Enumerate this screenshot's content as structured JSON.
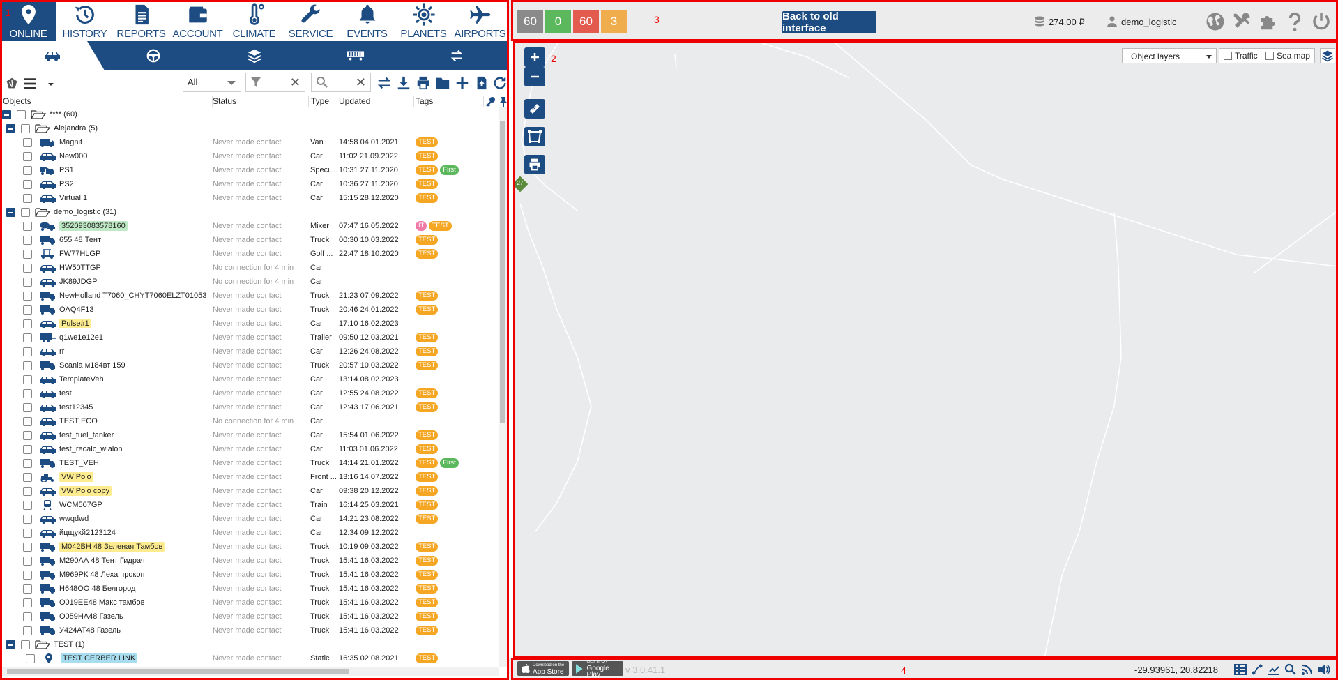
{
  "nav": {
    "items": [
      {
        "label": "ONLINE",
        "icon": "pin-icon"
      },
      {
        "label": "HISTORY",
        "icon": "history-icon"
      },
      {
        "label": "REPORTS",
        "icon": "report-icon"
      },
      {
        "label": "ACCOUNT",
        "icon": "wallet-icon"
      },
      {
        "label": "CLIMATE",
        "icon": "thermometer-icon"
      },
      {
        "label": "SERVICE",
        "icon": "wrench-icon"
      },
      {
        "label": "EVENTS",
        "icon": "bell-icon"
      },
      {
        "label": "PLANETS",
        "icon": "sun-icon"
      },
      {
        "label": "AIRPORTS",
        "icon": "plane-icon"
      }
    ]
  },
  "subtabs": [
    "car-icon",
    "steering-wheel-icon",
    "layers-icon",
    "train-icon",
    "swap-icon"
  ],
  "toolbar": {
    "filter_select_value": "All",
    "icons": [
      "transfer-icon",
      "download-icon",
      "print-icon",
      "folder-icon",
      "plus-icon",
      "upload-icon",
      "refresh-icon"
    ]
  },
  "columns": {
    "objects": "Objects",
    "status": "Status",
    "type": "Type",
    "updated": "Updated",
    "tags": "Tags"
  },
  "tags": {
    "test": "TEST",
    "first": "First",
    "it": "IT"
  },
  "colors": {
    "brand": "#1c4c82",
    "test_tag": "#f5a623",
    "first_tag": "#5cb85c",
    "it_tag": "#f07aa6",
    "hl_yellow": "#fdeb8f",
    "hl_green": "#bfe8c4",
    "hl_blue": "#a8ddef"
  },
  "rows": [
    {
      "kind": "group",
      "level": 0,
      "name": "**** (60)"
    },
    {
      "kind": "group",
      "level": 1,
      "name": "Alejandra (5)"
    },
    {
      "kind": "obj",
      "name": "Magnit",
      "status": "Never made contact",
      "type": "Van",
      "updated": "14:58 04.01.2021",
      "tags": [
        "test"
      ],
      "icon": "van-icon"
    },
    {
      "kind": "obj",
      "name": "New000",
      "status": "Never made contact",
      "type": "Car",
      "updated": "11:02 21.09.2022",
      "tags": [
        "test"
      ],
      "icon": "car-icon"
    },
    {
      "kind": "obj",
      "name": "PS1",
      "status": "Never made contact",
      "type": "Speci...",
      "updated": "10:31 27.11.2020",
      "tags": [
        "test",
        "first"
      ],
      "icon": "special-icon"
    },
    {
      "kind": "obj",
      "name": "PS2",
      "status": "Never made contact",
      "type": "Car",
      "updated": "10:36 27.11.2020",
      "tags": [
        "test"
      ],
      "icon": "car-icon"
    },
    {
      "kind": "obj",
      "name": "Virtual 1",
      "status": "Never made contact",
      "type": "Car",
      "updated": "15:15 28.12.2020",
      "tags": [
        "test"
      ],
      "icon": "car-icon"
    },
    {
      "kind": "group",
      "level": 1,
      "name": "demo_logistic (31)"
    },
    {
      "kind": "obj",
      "name": "352093083578160",
      "hl": "green",
      "status": "Never made contact",
      "type": "Mixer",
      "updated": "07:47 16.05.2022",
      "tags": [
        "it",
        "test"
      ],
      "icon": "mixer-icon"
    },
    {
      "kind": "obj",
      "name": "655 48 Тент",
      "status": "Never made contact",
      "type": "Truck",
      "updated": "00:30 10.03.2022",
      "tags": [
        "test"
      ],
      "icon": "truck-icon"
    },
    {
      "kind": "obj",
      "name": "FW77HLGP",
      "status": "Never made contact",
      "type": "Golf ...",
      "updated": "22:47 18.10.2020",
      "tags": [
        "test"
      ],
      "icon": "golf-icon"
    },
    {
      "kind": "obj",
      "name": "HW50TTGP",
      "status": "No connection for 4 min",
      "type": "Car",
      "updated": "",
      "tags": [],
      "icon": "car-icon"
    },
    {
      "kind": "obj",
      "name": "JK89JDGP",
      "status": "No connection for 4 min",
      "type": "Car",
      "updated": "",
      "tags": [],
      "icon": "car-icon"
    },
    {
      "kind": "obj",
      "name": "NewHolland T7060_CHYT7060ELZT01053",
      "status": "Never made contact",
      "type": "Truck",
      "updated": "21:23 07.09.2022",
      "tags": [
        "test"
      ],
      "icon": "truck-icon"
    },
    {
      "kind": "obj",
      "name": "OAQ4F13",
      "status": "Never made contact",
      "type": "Truck",
      "updated": "20:46 24.01.2022",
      "tags": [
        "test"
      ],
      "icon": "truck-icon"
    },
    {
      "kind": "obj",
      "name": "Pulse#1",
      "hl": "yellow",
      "status": "Never made contact",
      "type": "Car",
      "updated": "17:10 16.02.2023",
      "tags": [],
      "icon": "car-icon"
    },
    {
      "kind": "obj",
      "name": "q1we1e12e1",
      "status": "Never made contact",
      "type": "Trailer",
      "updated": "09:50 12.03.2021",
      "tags": [
        "test"
      ],
      "icon": "trailer-icon"
    },
    {
      "kind": "obj",
      "name": "rr",
      "status": "Never made contact",
      "type": "Car",
      "updated": "12:26 24.08.2022",
      "tags": [
        "test"
      ],
      "icon": "car-icon"
    },
    {
      "kind": "obj",
      "name": "Scania м184вт 159",
      "status": "Never made contact",
      "type": "Truck",
      "updated": "20:57 10.03.2022",
      "tags": [
        "test"
      ],
      "icon": "truck-icon"
    },
    {
      "kind": "obj",
      "name": "TemplateVeh",
      "status": "Never made contact",
      "type": "Car",
      "updated": "13:14 08.02.2023",
      "tags": [],
      "icon": "car-icon"
    },
    {
      "kind": "obj",
      "name": "test",
      "status": "Never made contact",
      "type": "Car",
      "updated": "12:55 24.08.2022",
      "tags": [
        "test"
      ],
      "icon": "car-icon"
    },
    {
      "kind": "obj",
      "name": "test12345",
      "status": "Never made contact",
      "type": "Car",
      "updated": "12:43 17.06.2021",
      "tags": [
        "test"
      ],
      "icon": "car-icon"
    },
    {
      "kind": "obj",
      "name": "TEST ECO",
      "status": "No connection for 4 min",
      "type": "Car",
      "updated": "",
      "tags": [],
      "icon": "car-icon"
    },
    {
      "kind": "obj",
      "name": "test_fuel_tanker",
      "status": "Never made contact",
      "type": "Car",
      "updated": "15:54 01.06.2022",
      "tags": [
        "test"
      ],
      "icon": "car-icon"
    },
    {
      "kind": "obj",
      "name": "test_recalc_wialon",
      "status": "Never made contact",
      "type": "Car",
      "updated": "11:03 01.06.2022",
      "tags": [
        "test"
      ],
      "icon": "car-icon"
    },
    {
      "kind": "obj",
      "name": "TEST_VEH",
      "status": "Never made contact",
      "type": "Truck",
      "updated": "14:14 21.01.2022",
      "tags": [
        "test",
        "first"
      ],
      "icon": "truck-icon"
    },
    {
      "kind": "obj",
      "name": "VW Polo",
      "hl": "yellow",
      "status": "Never made contact",
      "type": "Front ...",
      "updated": "13:16 14.07.2022",
      "tags": [
        "test"
      ],
      "icon": "tractor-icon"
    },
    {
      "kind": "obj",
      "name": "VW Polo copy",
      "hl": "yellow",
      "status": "Never made contact",
      "type": "Car",
      "updated": "09:38 20.12.2022",
      "tags": [
        "test"
      ],
      "icon": "car-icon"
    },
    {
      "kind": "obj",
      "name": "WCM507GP",
      "status": "Never made contact",
      "type": "Train",
      "updated": "16:14 25.03.2021",
      "tags": [
        "test"
      ],
      "icon": "train-icon"
    },
    {
      "kind": "obj",
      "name": "wwqdwd",
      "status": "Never made contact",
      "type": "Car",
      "updated": "14:21 23.08.2022",
      "tags": [
        "test"
      ],
      "icon": "car-icon"
    },
    {
      "kind": "obj",
      "name": "йцщукй2123124",
      "status": "Never made contact",
      "type": "Car",
      "updated": "12:34 09.12.2022",
      "tags": [],
      "icon": "car-icon"
    },
    {
      "kind": "obj",
      "name": "М042ВН 48 Зеленая Тамбов",
      "hl": "yellow",
      "status": "Never made contact",
      "type": "Truck",
      "updated": "10:19 09.03.2022",
      "tags": [
        "test"
      ],
      "icon": "truck-icon"
    },
    {
      "kind": "obj",
      "name": "М290АА 48 Тент Гидрач",
      "status": "Never made contact",
      "type": "Truck",
      "updated": "15:41 16.03.2022",
      "tags": [
        "test"
      ],
      "icon": "truck-icon"
    },
    {
      "kind": "obj",
      "name": "М969РК 48 Леха прокоп",
      "status": "Never made contact",
      "type": "Truck",
      "updated": "15:41 16.03.2022",
      "tags": [
        "test"
      ],
      "icon": "truck-icon"
    },
    {
      "kind": "obj",
      "name": "Н648ОО 48 Белгород",
      "status": "Never made contact",
      "type": "Truck",
      "updated": "15:41 16.03.2022",
      "tags": [
        "test"
      ],
      "icon": "truck-icon"
    },
    {
      "kind": "obj",
      "name": "О019ЕЕ48 Макс тамбов",
      "status": "Never made contact",
      "type": "Truck",
      "updated": "15:41 16.03.2022",
      "tags": [
        "test"
      ],
      "icon": "truck-icon"
    },
    {
      "kind": "obj",
      "name": "О059НА48 Газель",
      "status": "Never made contact",
      "type": "Truck",
      "updated": "15:41 16.03.2022",
      "tags": [
        "test"
      ],
      "icon": "truck-icon"
    },
    {
      "kind": "obj",
      "name": "У424АТ48 Газель",
      "status": "Never made contact",
      "type": "Truck",
      "updated": "15:41 16.03.2022",
      "tags": [
        "test"
      ],
      "icon": "truck-icon"
    },
    {
      "kind": "group",
      "level": 1,
      "name": "TEST (1)"
    },
    {
      "kind": "obj",
      "name": "TEST CERBER LINK",
      "hl": "blue",
      "status": "Never made contact",
      "type": "Static",
      "updated": "16:35 02.08.2021",
      "tags": [
        "test"
      ],
      "icon": "pin-icon",
      "indent": 2
    }
  ],
  "topbar": {
    "counters": [
      {
        "value": "60",
        "color": "#8a8a8a"
      },
      {
        "value": "0",
        "color": "#5cb85c"
      },
      {
        "value": "60",
        "color": "#e35b4f"
      },
      {
        "value": "3",
        "color": "#f0ad4e"
      }
    ],
    "back_button": "Back to old interface",
    "balance": "274.00 ₽",
    "user": "demo_logistic",
    "icons": [
      "globe-icon",
      "tools-icon",
      "puzzle-icon",
      "help-icon",
      "power-icon"
    ]
  },
  "map": {
    "layers_select": "Object layers",
    "traffic": "Traffic",
    "sea_map": "Sea map",
    "marker_label": "27"
  },
  "bottombar": {
    "app_store": "App Store",
    "app_store_small": "Download on the",
    "google_play": "Google Play",
    "google_play_small": "GET IT ON",
    "version": "v 3.0.41.1",
    "coords": "-29.93961, 20.82218"
  },
  "annotations": [
    "1",
    "2",
    "3",
    "4"
  ]
}
